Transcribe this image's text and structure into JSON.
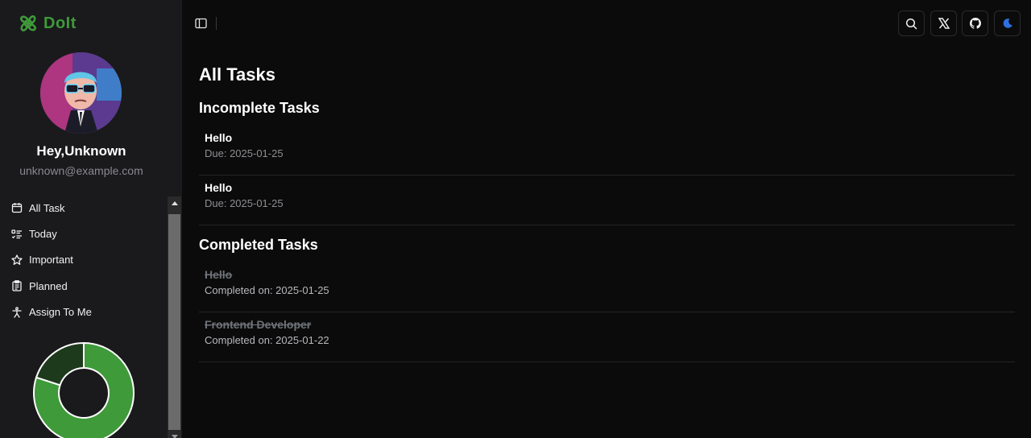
{
  "app": {
    "name": "DoIt",
    "accent": "#3f9a3a"
  },
  "user": {
    "greeting": "Hey,Unknown",
    "email": "unknown@example.com"
  },
  "nav": {
    "items": [
      {
        "label": "All Task",
        "icon": "calendar-icon"
      },
      {
        "label": "Today",
        "icon": "list-checks-icon"
      },
      {
        "label": "Important",
        "icon": "star-icon"
      },
      {
        "label": "Planned",
        "icon": "clipboard-icon"
      },
      {
        "label": "Assign To Me",
        "icon": "person-icon"
      }
    ]
  },
  "stats_chart": {
    "type": "donut",
    "completed_fraction": 0.8,
    "colors": {
      "completed": "#3f9a3a",
      "pending": "#1d3a1c"
    }
  },
  "topbar": {
    "icons": [
      "sidebar-toggle-icon",
      "search-icon",
      "x-logo-icon",
      "github-icon",
      "moon-icon"
    ]
  },
  "main": {
    "title": "All Tasks",
    "incomplete": {
      "heading": "Incomplete Tasks",
      "tasks": [
        {
          "title": "Hello",
          "meta": "Due: 2025-01-25"
        },
        {
          "title": "Hello",
          "meta": "Due: 2025-01-25"
        }
      ]
    },
    "completed": {
      "heading": "Completed Tasks",
      "tasks": [
        {
          "title": "Hello",
          "meta": "Completed on: 2025-01-25"
        },
        {
          "title": "Frontend Developer",
          "meta": "Completed on: 2025-01-22"
        }
      ]
    }
  }
}
